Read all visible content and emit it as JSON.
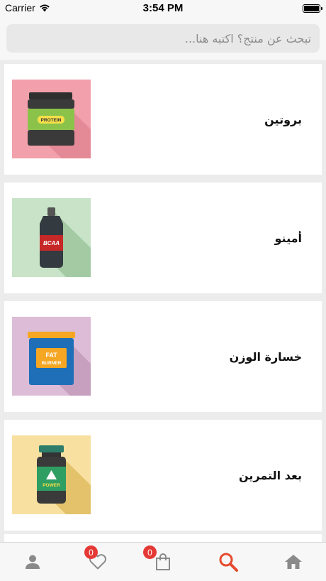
{
  "status_bar": {
    "carrier": "Carrier",
    "time": "3:54 PM",
    "battery_level": 1.0
  },
  "search": {
    "placeholder": "تبحث عن منتج؟ اكتبه هنا..."
  },
  "categories": [
    {
      "label": "بروتين",
      "icon": "protein-jar-icon",
      "bg": "#f2a0ac",
      "image_text": "PROTEIN"
    },
    {
      "label": "أمينو",
      "icon": "bcaa-bottle-icon",
      "bg": "#c8e3c8",
      "image_text": "BCAA"
    },
    {
      "label": "خسارة الوزن",
      "icon": "fat-burner-tub-icon",
      "bg": "#dcbcd6",
      "image_text": "FAT BURNER"
    },
    {
      "label": "بعد التمرين",
      "icon": "power-jar-icon",
      "bg": "#f8e1a0",
      "image_text": "POWER"
    }
  ],
  "tabbar": {
    "tabs": [
      {
        "name": "profile",
        "icon": "user-icon",
        "active": false
      },
      {
        "name": "favorites",
        "icon": "heart-icon",
        "badge": "0",
        "active": false
      },
      {
        "name": "cart",
        "icon": "shopping-bag-icon",
        "badge": "0",
        "active": false
      },
      {
        "name": "search",
        "icon": "search-icon",
        "active": true
      },
      {
        "name": "home",
        "icon": "home-icon",
        "active": false
      }
    ]
  },
  "colors": {
    "accent": "#e64a2e",
    "inactive_icon": "#8a8a8a",
    "badge": "#e53935"
  }
}
